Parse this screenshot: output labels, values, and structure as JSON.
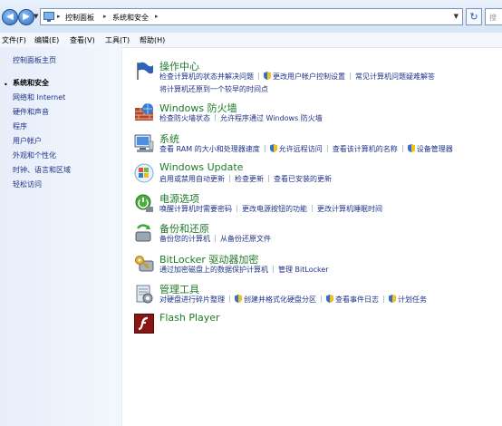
{
  "address": {
    "crumbs": [
      "控制面板",
      "系统和安全"
    ],
    "search_placeholder": "搜"
  },
  "menu": [
    "文件(F)",
    "编辑(E)",
    "查看(V)",
    "工具(T)",
    "帮助(H)"
  ],
  "sidebar": {
    "home": "控制面板主页",
    "items": [
      "系统和安全",
      "网络和 Internet",
      "硬件和声音",
      "程序",
      "用户帐户",
      "外观和个性化",
      "时钟、语言和区域",
      "轻松访问"
    ]
  },
  "categories": [
    {
      "title": "操作中心",
      "line1": [
        "检查计算机的状态并解决问题",
        "更改用户帐户控制设置",
        "常见计算机问题疑难解答"
      ],
      "line2": [
        "将计算机还原到一个较早的时间点"
      ]
    },
    {
      "title": "Windows 防火墙",
      "line1": [
        "检查防火墙状态",
        "允许程序通过 Windows 防火墙"
      ]
    },
    {
      "title": "系统",
      "line1": [
        "查看 RAM 的大小和处理器速度",
        "允许远程访问",
        "查看该计算机的名称",
        "设备管理器"
      ]
    },
    {
      "title": "Windows Update",
      "line1": [
        "启用或禁用自动更新",
        "检查更新",
        "查看已安装的更新"
      ]
    },
    {
      "title": "电源选项",
      "line1": [
        "唤醒计算机时需要密码",
        "更改电源按钮的功能",
        "更改计算机睡眠时间"
      ]
    },
    {
      "title": "备份和还原",
      "line1": [
        "备份您的计算机",
        "从备份还原文件"
      ]
    },
    {
      "title": "BitLocker 驱动器加密",
      "line1": [
        "通过加密磁盘上的数据保护计算机",
        "管理 BitLocker"
      ]
    },
    {
      "title": "管理工具",
      "line1": [
        "对硬盘进行碎片整理",
        "创建并格式化硬盘分区",
        "查看事件日志",
        "计划任务"
      ]
    },
    {
      "title": "Flash Player"
    }
  ]
}
